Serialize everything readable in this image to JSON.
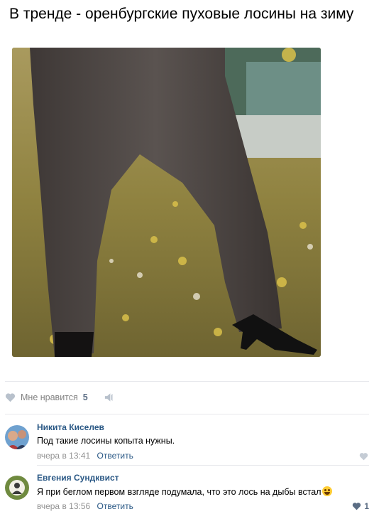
{
  "post": {
    "title": "В тренде - оренбургские пуховые лосины на зиму"
  },
  "likes": {
    "label": "Мне нравится",
    "count": "5"
  },
  "comments": [
    {
      "author": "Никита Киселев",
      "text": "Под такие лосины копыта нужны.",
      "time": "вчера в 13:41",
      "reply_label": "Ответить",
      "likes": ""
    },
    {
      "author": "Евгения Сундквист",
      "text": "Я при беглом первом взгляде подумала, что это лось на дыбы встал",
      "time": "вчера в 13:56",
      "reply_label": "Ответить",
      "likes": "1"
    }
  ],
  "colors": {
    "link": "#2a5885",
    "muted": "#939393",
    "divider": "#e7e8ec"
  },
  "icons": [
    "heart-icon",
    "share-icon",
    "laugh-emoji-icon"
  ]
}
